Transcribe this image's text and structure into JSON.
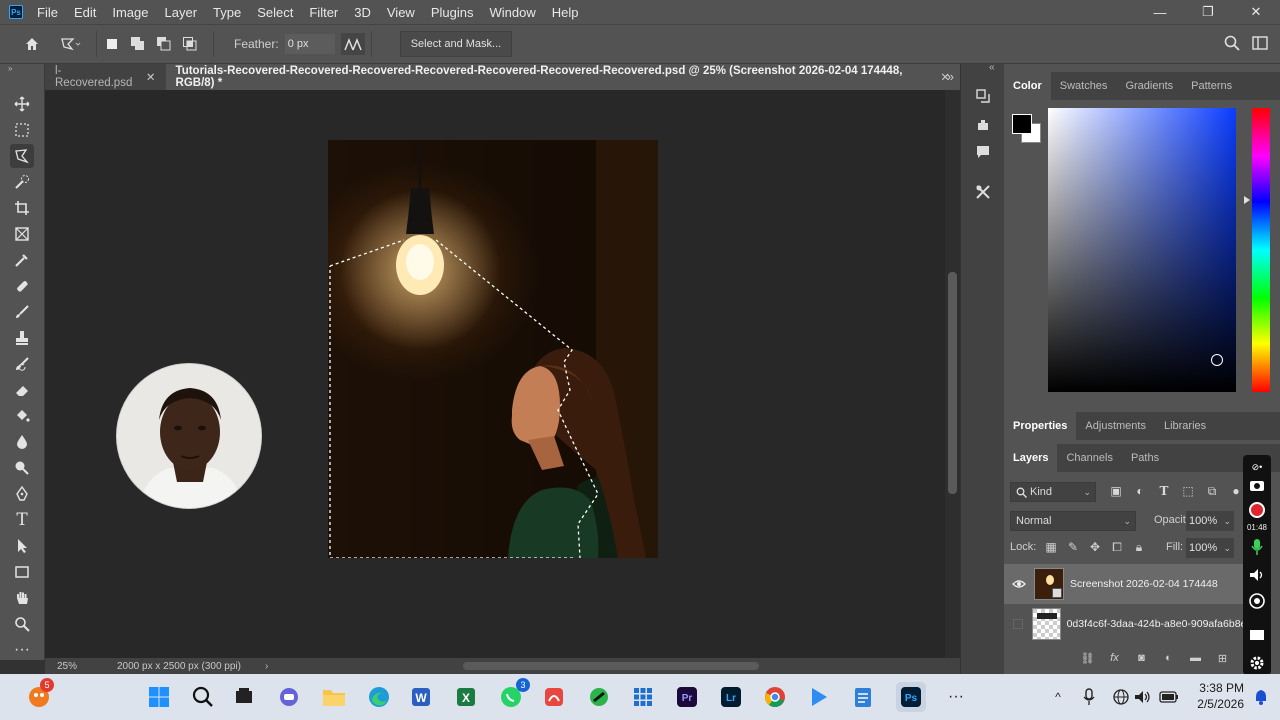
{
  "app": {
    "logo": "Ps"
  },
  "menu": [
    "File",
    "Edit",
    "Image",
    "Layer",
    "Type",
    "Select",
    "Filter",
    "3D",
    "View",
    "Plugins",
    "Window",
    "Help"
  ],
  "options": {
    "feather_label": "Feather:",
    "feather_value": "0 px",
    "select_and_mask": "Select and Mask..."
  },
  "tabs": [
    {
      "label": "l-Recovered.psd"
    },
    {
      "label": "Tutorials-Recovered-Recovered-Recovered-Recovered-Recovered-Recovered-Recovered.psd @ 25% (Screenshot 2026-02-04 174448, RGB/8) *"
    }
  ],
  "status": {
    "zoom": "25%",
    "doc_size": "2000 px x 2500 px (300 ppi)"
  },
  "color_panel": {
    "tabs": [
      "Color",
      "Swatches",
      "Gradients",
      "Patterns"
    ],
    "foreground": "#000000",
    "background": "#ffffff"
  },
  "properties": {
    "tabs": [
      "Properties",
      "Adjustments",
      "Libraries"
    ]
  },
  "layers_panel": {
    "tabs": [
      "Layers",
      "Channels",
      "Paths"
    ],
    "filter": "Kind",
    "blend_mode": "Normal",
    "opacity_label": "Opacity:",
    "opacity": "100%",
    "lock_label": "Lock:",
    "fill_label": "Fill:",
    "fill": "100%",
    "layers": [
      {
        "name": "Screenshot 2026-02-04 174448",
        "visible": true,
        "selected": true
      },
      {
        "name": "0d3f4c6f-3daa-424b-a8e0-909afa6b8e...",
        "visible": false,
        "selected": false
      }
    ]
  },
  "recorder": {
    "time": "01:48"
  },
  "taskbar": {
    "time": "3:38 PM",
    "date": "2/5/2026",
    "badges": {
      "notifications": "5",
      "whatsapp": "3"
    }
  }
}
